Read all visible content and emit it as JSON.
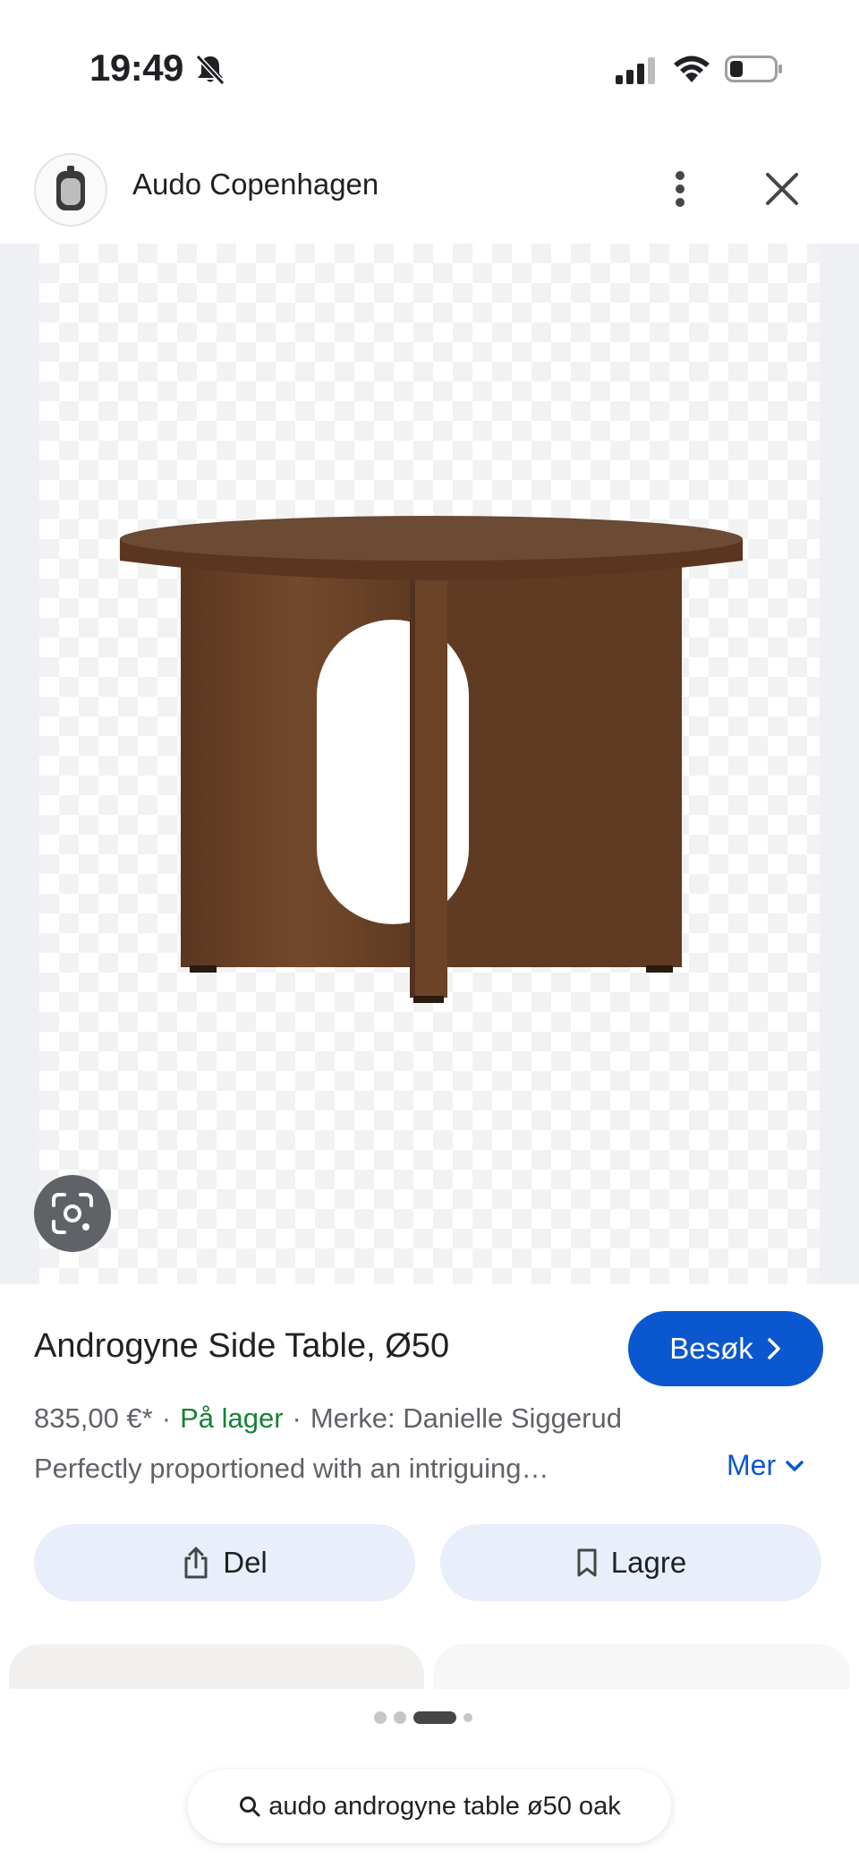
{
  "status_bar": {
    "time": "19:49",
    "icons": [
      "bell-slash-icon",
      "cellular-signal-icon",
      "wifi-icon",
      "battery-icon"
    ]
  },
  "header": {
    "site_name": "Audo Copenhagen",
    "icons": [
      "site-logo",
      "more-vertical-icon",
      "close-icon"
    ]
  },
  "product": {
    "title": "Androgyne Side Table, Ø50",
    "visit_label": "Besøk",
    "price": "835,00 €*",
    "stock": "På lager",
    "brand": "Merke: Danielle Siggerud",
    "description": "Perfectly proportioned with an intriguing…",
    "more_label": "Mer"
  },
  "actions": {
    "share_label": "Del",
    "save_label": "Lagre"
  },
  "search": {
    "query": "audo androgyne table ø50 oak"
  },
  "colors": {
    "accent": "#0b57d0",
    "in_stock": "#188038",
    "button_bg": "#e8eefa",
    "wood": "#6b4226"
  }
}
